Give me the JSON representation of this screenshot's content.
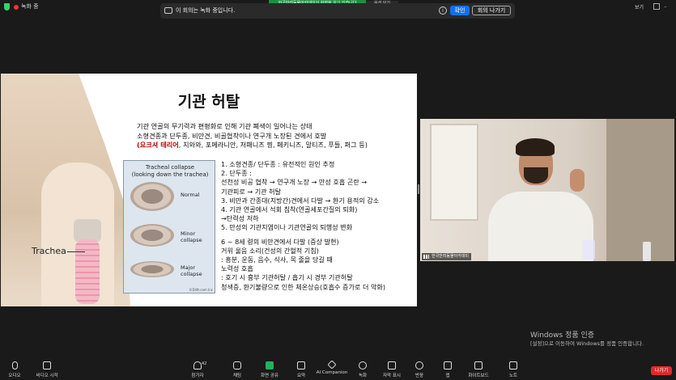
{
  "topbar": {
    "rec_label": "녹화 중",
    "share_banner": "한국반려동물아카데미의 화면을 보고 있습니다",
    "view_button": "옵션 보기",
    "notice_text": "이 회의는 녹화 중입니다.",
    "ok_button": "확인",
    "leave_meeting_button": "회의 나가기",
    "view_right": "보기",
    "info_icon": "i"
  },
  "slide": {
    "title": "기관 허탈",
    "intro_line1": "기관 연골의 무기력과 편평화로 인해 기관 폐색이 일어나는 상태",
    "intro_line2": "소형견종과 단두종, 비만견, 비골협착이나 연구개 노장된 견에서 호발",
    "intro_red": "(요크셔 테리어",
    "intro_line3_rest": ", 치와와, 포메라니안, 저패니즈 찡, 페키니즈, 말티즈, 푸들, 퍼그 등)",
    "trachea_label": "Trachea",
    "diagram": {
      "title_line1": "Tracheal collapse",
      "title_line2": "(looking down the trachea)",
      "normal": "Normal",
      "minor_1": "Minor",
      "minor_2": "collapse",
      "major_1": "Major",
      "major_2": "collapse",
      "credit": "©Dlitt.com Inc"
    },
    "points": [
      "1.  소형견종/ 단두종 : 유전적인 원인 추정",
      "2.  단두종 :",
      "     선천성 비공 협착 → 연구개 노장 → 만성 호흡 곤란 →",
      "     기관피로 → 기관 허탈",
      "3. 비만과 간종대(지방간)견에서 다발 → 환기 용적의 감소",
      "4. 기관 연골에서 석회 침착(연골세포간질의 퇴화)",
      "     →탄력성 저하",
      "5. 만성의 기관지염이나 기관연골의 퇴행성 변화",
      "",
      "6 ~ 8세 령의 비만견에서 다발 (증상 발현)",
      "거위 울음 소리(건성의 간헐적 기침)",
      ": 흥분, 운동, 음수, 식사, 목 줄을 당길 때",
      "노력성 호흡",
      ": 호기 시 흉부 기관허탈 / 흡기 시 경부 기관허탈",
      "청색증, 환기불량으로 인한 체온상승(호흡수 증가로 더 악화)"
    ]
  },
  "video": {
    "participant_name": "한국반려동물아카데미"
  },
  "watermark": {
    "title": "Windows 정품 인증",
    "subtitle": "[설정]으로 이동하여 Windows를 정품 인증합니다."
  },
  "toolbar": {
    "audio": "오디오",
    "video": "비디오 시작",
    "participants": "참가자",
    "participants_count": "42",
    "chat": "채팅",
    "share": "화면 공유",
    "summary": "요약",
    "ai": "AI Companion",
    "record": "녹화",
    "captions": "자막 표시",
    "reactions": "반응",
    "apps": "앱",
    "whiteboard": "화이트보드",
    "notes": "노트",
    "leave": "나가기"
  }
}
